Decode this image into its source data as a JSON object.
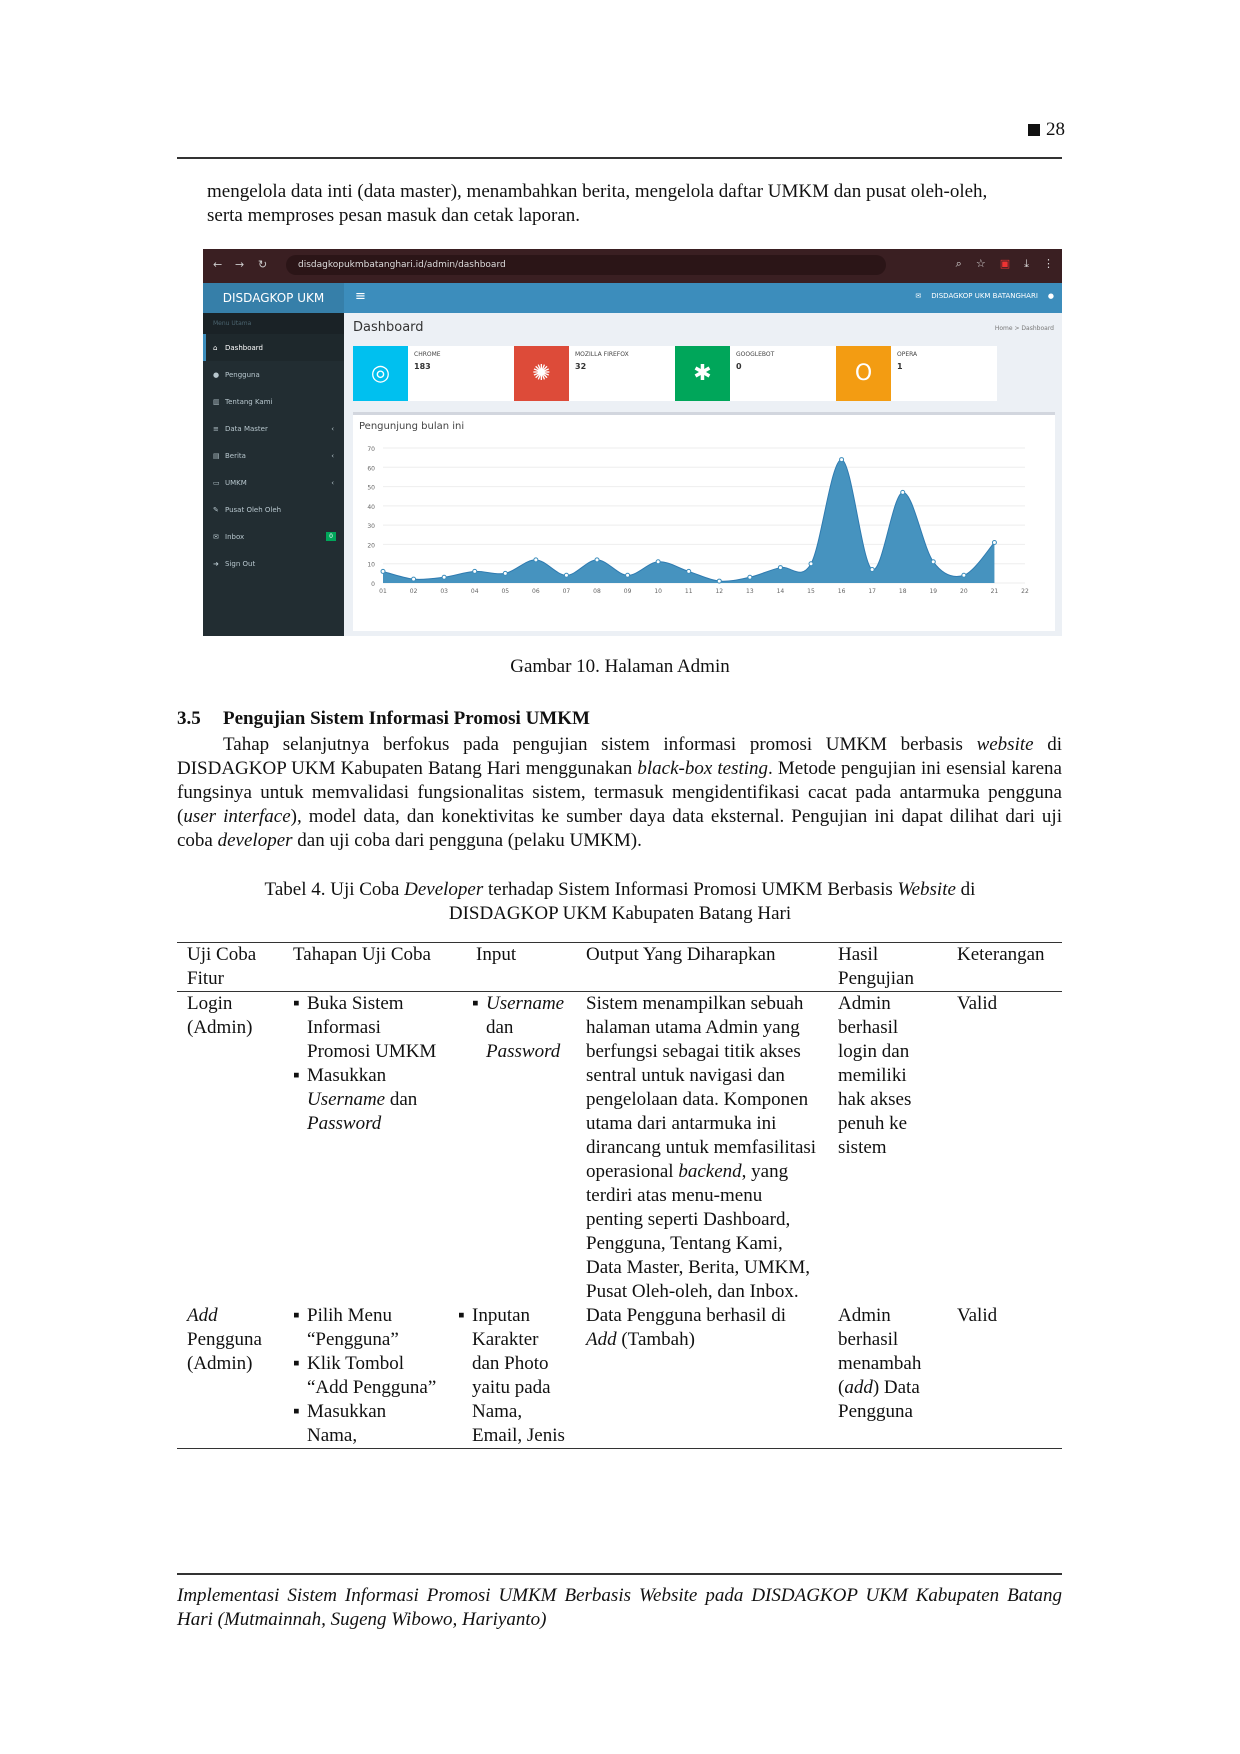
{
  "header": {
    "page_number": "28"
  },
  "intro": {
    "line1": "mengelola data inti (data master), menambahkan berita, mengelola daftar UMKM dan pusat oleh-oleh,",
    "line2": "serta memproses pesan masuk dan cetak laporan."
  },
  "screenshot": {
    "url": "disdagkopukmbatanghari.id/admin/dashboard",
    "logo": "DISDAGKOP UKM",
    "user": "DISDAGKOP UKM BATANGHARI",
    "sidebar_head": "Menu Utama",
    "sidebar_items": [
      {
        "label": "Dashboard",
        "icon": "home-icon",
        "active": true
      },
      {
        "label": "Pengguna",
        "icon": "user-icon"
      },
      {
        "label": "Tentang Kami",
        "icon": "bank-icon"
      },
      {
        "label": "Data Master",
        "icon": "list-icon",
        "chevron": "‹"
      },
      {
        "label": "Berita",
        "icon": "newspaper-icon",
        "chevron": "‹"
      },
      {
        "label": "UMKM",
        "icon": "card-icon",
        "chevron": "‹"
      },
      {
        "label": "Pusat Oleh Oleh",
        "icon": "tag-icon"
      },
      {
        "label": "Inbox",
        "icon": "envelope-icon",
        "badge": "0"
      },
      {
        "label": "Sign Out",
        "icon": "sign-out-icon"
      }
    ],
    "page_title": "Dashboard",
    "breadcrumb": "Home > Dashboard",
    "stats": [
      {
        "label": "CHROME",
        "value": "183",
        "color": "#00c0ef",
        "icon": "chrome-icon"
      },
      {
        "label": "MOZILLA FIREFOX",
        "value": "32",
        "color": "#dd4b39",
        "icon": "firefox-icon"
      },
      {
        "label": "GOOGLEBOT",
        "value": "0",
        "color": "#00a65a",
        "icon": "bug-icon"
      },
      {
        "label": "OPERA",
        "value": "1",
        "color": "#f39c12",
        "icon": "opera-icon"
      }
    ],
    "chart_title": "Pengunjung bulan ini"
  },
  "chart_data": {
    "type": "area",
    "title": "Pengunjung bulan ini",
    "xlabel": "",
    "ylabel": "",
    "categories": [
      "01",
      "02",
      "03",
      "04",
      "05",
      "06",
      "07",
      "08",
      "09",
      "10",
      "11",
      "12",
      "13",
      "14",
      "15",
      "16",
      "17",
      "18",
      "19",
      "20",
      "21",
      "22"
    ],
    "values": [
      6,
      2,
      3,
      6,
      5,
      12,
      4,
      12,
      4,
      11,
      6,
      1,
      3,
      8,
      10,
      64,
      7,
      47,
      11,
      4,
      21
    ],
    "x_values": [
      "01",
      "02",
      "03",
      "04",
      "05",
      "06",
      "07",
      "08",
      "09",
      "10",
      "11",
      "12",
      "13",
      "14",
      "15",
      "16",
      "17",
      "18",
      "19",
      "20",
      "21"
    ],
    "ylim": [
      0,
      70
    ],
    "yticks": [
      0,
      10,
      20,
      30,
      40,
      50,
      60,
      70
    ],
    "color": "#3c8dbc",
    "grid": true
  },
  "figure_caption": "Gambar 10. Halaman Admin",
  "section": {
    "number": "3.5",
    "title": "Pengujian Sistem Informasi Promosi UMKM",
    "p1a": "Tahap selanjutnya berfokus pada pengujian sistem informasi promosi UMKM berbasis ",
    "p1b": "website",
    "p1c": " di DISDAGKOP UKM Kabupaten Batang Hari menggunakan ",
    "p1d": "black-box testing",
    "p1e": ". Metode pengujian ini esensial karena fungsinya untuk memvalidasi fungsionalitas sistem, termasuk mengidentifikasi cacat pada antarmuka pengguna (",
    "p1f": "user interface",
    "p1g": "), model data, dan konektivitas ke sumber daya data eksternal. Pengujian ini dapat dilihat dari uji coba ",
    "p1h": "developer",
    "p1i": " dan uji coba dari pengguna (pelaku UMKM)."
  },
  "table_caption": {
    "a": "Tabel 4. Uji Coba ",
    "b": "Developer",
    "c": " terhadap Sistem Informasi Promosi UMKM Berbasis ",
    "d": "Website",
    "e": " di",
    "f": "DISDAGKOP UKM Kabupaten Batang Hari"
  },
  "table": {
    "headers": [
      "Uji  Coba Fitur",
      "Tahapan Uji Coba",
      "Input",
      "Output Yang Diharapkan",
      "Hasil Pengujian",
      "Keterangan"
    ],
    "row1": {
      "fitur": "Login (Admin)",
      "step1": "Buka Sistem Informasi Promosi UMKM",
      "step2a": "Masukkan ",
      "step2b": "Username",
      "step2c": " dan ",
      "step2d": "Password",
      "input_a": "Username",
      "input_b": " dan ",
      "input_c": "Password",
      "output_a": "Sistem menampilkan sebuah halaman utama Admin yang berfungsi sebagai titik akses sentral untuk navigasi dan pengelolaan data. Komponen utama dari antarmuka ini dirancang untuk memfasilitasi operasional ",
      "output_b": "backend",
      "output_c": ", yang terdiri atas menu-menu penting seperti Dashboard, Pengguna, Tentang Kami, Data Master, Berita, UMKM, Pusat Oleh-oleh, dan Inbox.",
      "hasil": "Admin berhasil login dan memiliki hak akses penuh ke sistem",
      "ket": "Valid"
    },
    "row2": {
      "fitur_a": "Add",
      "fitur_b": " Pengguna (Admin)",
      "step1": "Pilih Menu “Pengguna”",
      "step2": "Klik Tombol “Add Pengguna”",
      "step3": "Masukkan Nama,",
      "input": "Inputan Karakter dan Photo yaitu pada Nama, Email, Jenis",
      "output_a": "Data Pengguna berhasil di ",
      "output_b": "Add",
      "output_c": " (Tambah)",
      "hasil_a": "Admin berhasil menambah (",
      "hasil_b": "add",
      "hasil_c": ") Data Pengguna",
      "ket": "Valid"
    }
  },
  "footer": "Implementasi Sistem Informasi Promosi UMKM Berbasis Website pada DISDAGKOP UKM Kabupaten Batang Hari (Mutmainnah, Sugeng Wibowo, Hariyanto)"
}
